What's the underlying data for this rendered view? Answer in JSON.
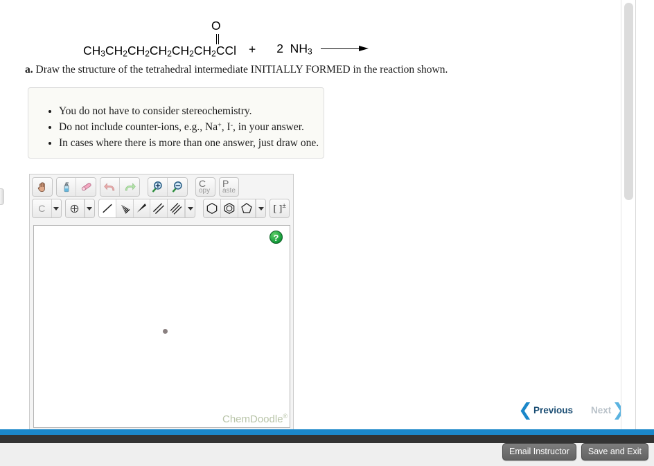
{
  "reaction": {
    "reactant_chain": "CH3CH2CH2CH2CH2CH2CCl",
    "reactant_display": [
      {
        "text": "CH",
        "sub": "3"
      },
      {
        "text": "CH",
        "sub": "2"
      },
      {
        "text": "CH",
        "sub": "2"
      },
      {
        "text": "CH",
        "sub": "2"
      },
      {
        "text": "CH",
        "sub": "2"
      },
      {
        "text": "CH",
        "sub": "2"
      },
      {
        "text": "CCl",
        "sub": ""
      }
    ],
    "carbonyl_oxygen": "O",
    "plus": "+",
    "coefficient": "2",
    "ammonia": "NH",
    "ammonia_sub": "3",
    "arrow": "reaction-arrow-right"
  },
  "question": {
    "label": "a.",
    "text": "Draw the structure of the tetrahedral intermediate INITIALLY FORMED in the reaction shown."
  },
  "instructions": {
    "items": [
      "You do not have to consider stereochemistry.",
      "Do not include counter-ions, e.g., Na+, I-, in your answer.",
      "In cases where there is more than one answer, just draw one."
    ],
    "item2_parts": {
      "before": "Do not include counter-ions, e.g., Na",
      "sup1": "+",
      "middle": ", I",
      "sup2": "-",
      "after": ", in your answer."
    }
  },
  "sketcher": {
    "toolbar_row1": [
      {
        "name": "hand-tool",
        "title": "Pan / Move"
      },
      {
        "name": "clear-tool",
        "title": "Clear"
      },
      {
        "name": "eraser-tool",
        "title": "Erase"
      },
      {
        "name": "undo-tool",
        "title": "Undo"
      },
      {
        "name": "redo-tool",
        "title": "Redo"
      },
      {
        "name": "zoom-in-tool",
        "title": "Zoom In"
      },
      {
        "name": "zoom-out-tool",
        "title": "Zoom Out"
      },
      {
        "name": "copy-tool",
        "title": "Copy"
      },
      {
        "name": "paste-tool",
        "title": "Paste"
      }
    ],
    "copy_button": {
      "big": "C",
      "small": "opy"
    },
    "paste_button": {
      "big": "P",
      "small": "aste"
    },
    "element_label": "C",
    "toolbar_row2": [
      {
        "name": "element-picker",
        "title": "C"
      },
      {
        "name": "charge-tool",
        "title": "Charge"
      },
      {
        "name": "single-bond-tool",
        "title": "Single Bond",
        "selected": true
      },
      {
        "name": "hashed-bond-tool",
        "title": "Hashed Wedge Bond"
      },
      {
        "name": "wedge-bond-tool",
        "title": "Wedge Bond"
      },
      {
        "name": "double-bond-tool",
        "title": "Double Bond"
      },
      {
        "name": "triple-bond-tool",
        "title": "Triple Bond"
      },
      {
        "name": "benzene-ring-tool",
        "title": "Cyclohexane Ring"
      },
      {
        "name": "aromatic-ring-tool",
        "title": "Benzene Ring"
      },
      {
        "name": "cyclopentane-ring-tool",
        "title": "Cyclopentane Ring"
      },
      {
        "name": "bracket-charge-tool",
        "title": "Brackets and Charge"
      }
    ],
    "bracket_label": "[ ]",
    "bracket_sup": "±",
    "help_label": "?",
    "watermark": "ChemDoodle",
    "watermark_sup": "®"
  },
  "navigation": {
    "previous_label": "Previous",
    "next_label": "Next",
    "prev_chevron": "❮",
    "next_chevron": "❯"
  },
  "footer": {
    "email_instructor_label": "Email Instructor",
    "save_and_exit_label": "Save and Exit"
  },
  "colors": {
    "accent_blue": "#1b87c9",
    "dark_bar": "#333333",
    "footer_bg": "#efefef",
    "button_grey": "#6e6e6e",
    "help_green": "#149b3a",
    "watermark": "#b8c4a8"
  }
}
